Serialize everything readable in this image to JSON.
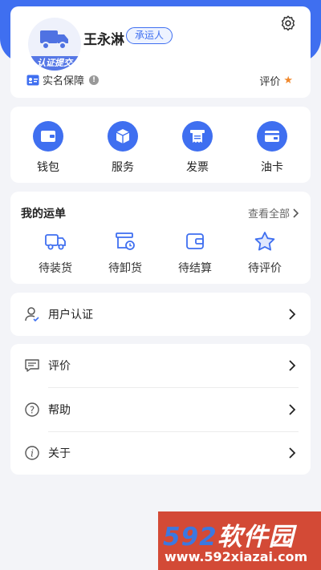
{
  "profile": {
    "name": "王永淋",
    "role": "承运人",
    "avatar_badge": "认证提交",
    "realname_label": "实名保障",
    "info_mark": "!",
    "rating_label": "评价",
    "rating_icon": "star-icon",
    "accent_color": "#3f6ff0"
  },
  "quick_actions": [
    {
      "label": "钱包",
      "icon": "wallet-icon"
    },
    {
      "label": "服务",
      "icon": "box-icon"
    },
    {
      "label": "发票",
      "icon": "invoice-icon"
    },
    {
      "label": "油卡",
      "icon": "card-icon"
    }
  ],
  "orders": {
    "title": "我的运单",
    "view_all": "查看全部",
    "items": [
      {
        "label": "待装货",
        "icon": "truck-icon"
      },
      {
        "label": "待卸货",
        "icon": "unload-clock-icon"
      },
      {
        "label": "待结算",
        "icon": "wallet-outline-icon"
      },
      {
        "label": "待评价",
        "icon": "star-outline-icon"
      }
    ]
  },
  "verify": {
    "label": "用户认证"
  },
  "menu": [
    {
      "label": "评价",
      "icon": "comment-icon"
    },
    {
      "label": "帮助",
      "icon": "help-icon",
      "glyph": "?"
    },
    {
      "label": "关于",
      "icon": "info-icon",
      "glyph": "i"
    }
  ],
  "watermark": {
    "brand_num": "592",
    "brand_text": "软件园",
    "url": "www.592xiazai.com"
  }
}
